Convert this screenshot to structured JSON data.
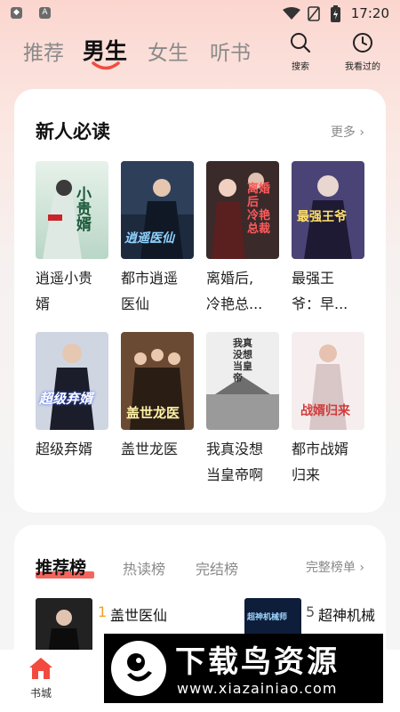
{
  "status_bar": {
    "time": "17:20",
    "icons": [
      "shield-icon",
      "a-icon",
      "wifi-icon",
      "no-sim-icon",
      "battery-icon"
    ]
  },
  "top_tabs": [
    {
      "label": "推荐",
      "active": false
    },
    {
      "label": "男生",
      "active": true
    },
    {
      "label": "女生",
      "active": false
    },
    {
      "label": "听书",
      "active": false
    }
  ],
  "top_actions": {
    "search_label": "搜索",
    "history_label": "我看过的"
  },
  "new_reader": {
    "title": "新人必读",
    "more_label": "更多",
    "books": [
      {
        "line1": "逍遥小贵",
        "line2": "婿"
      },
      {
        "line1": "都市逍遥",
        "line2": "医仙"
      },
      {
        "line1": "离婚后,",
        "line2": "冷艳总..."
      },
      {
        "line1": "最强王",
        "line2": "爷：早..."
      },
      {
        "line1": "超级弃婿",
        "line2": ""
      },
      {
        "line1": "盖世龙医",
        "line2": ""
      },
      {
        "line1": "我真没想",
        "line2": "当皇帝啊"
      },
      {
        "line1": "都市战婿",
        "line2": "归来"
      }
    ],
    "cover_texts": [
      "小贵婿",
      "逍遥医仙",
      "离婚后 冷艳总裁",
      "最强王爷",
      "超级弃婿",
      "盖世龙医",
      "我真没想当皇帝",
      "战婿归来"
    ]
  },
  "ranking": {
    "tabs": [
      {
        "label": "推荐榜",
        "active": true
      },
      {
        "label": "热读榜",
        "active": false
      },
      {
        "label": "完结榜",
        "active": false
      }
    ],
    "full_label": "完整榜单",
    "items": [
      {
        "rank": "1",
        "title": "盖世医仙"
      },
      {
        "rank": "5",
        "title": "超神机械"
      }
    ],
    "cover_text": "超神机械师"
  },
  "bottom_nav": {
    "home_label": "书城"
  },
  "watermark": {
    "title": "下载鸟资源",
    "url": "www.xiazainiao.com"
  },
  "colors": {
    "accent": "#f34a3f",
    "rank_number": "#f0a020"
  }
}
